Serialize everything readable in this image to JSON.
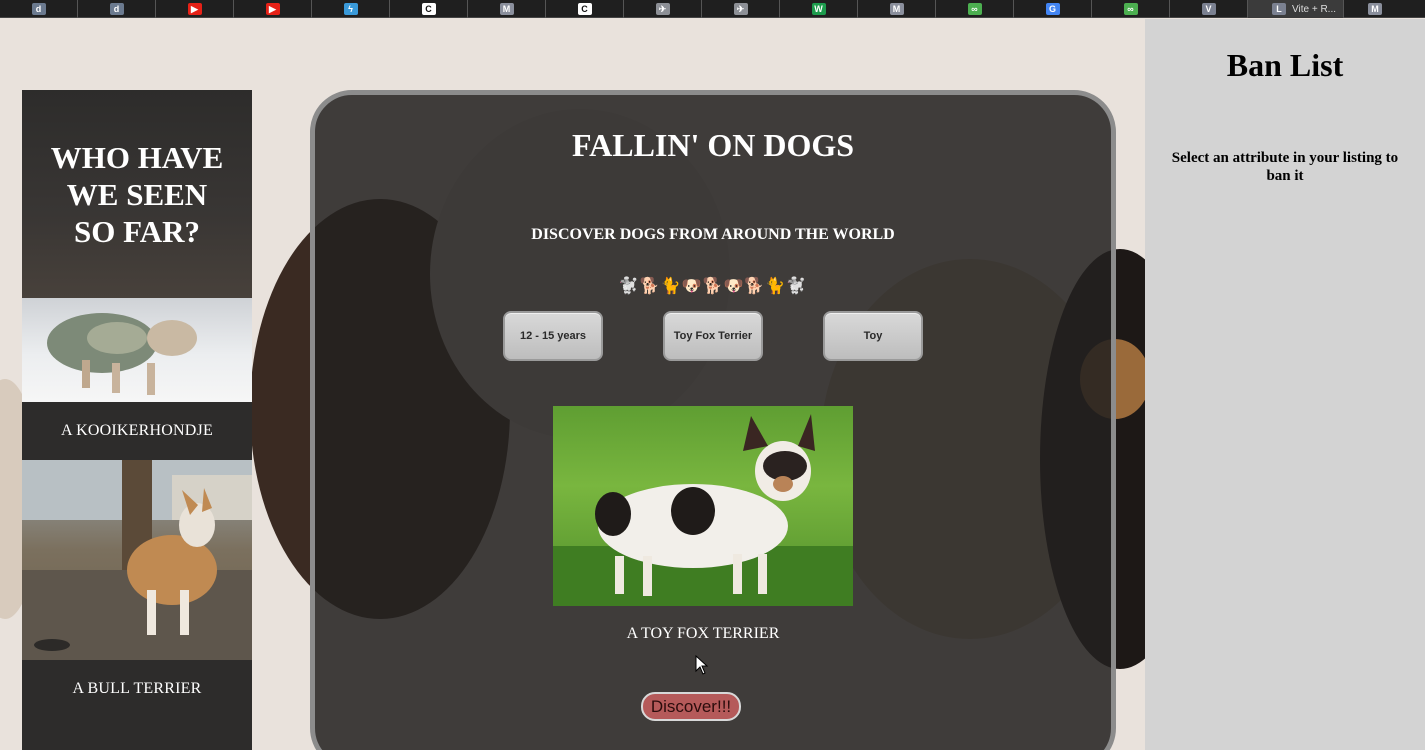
{
  "browser": {
    "tabs": [
      {
        "icon": "dict-icon",
        "label": "",
        "color": "#6b7a8f"
      },
      {
        "icon": "dict-icon",
        "label": "",
        "color": "#6b7a8f"
      },
      {
        "icon": "youtube-icon",
        "label": "",
        "color": "#e62117"
      },
      {
        "icon": "youtube-icon",
        "label": "",
        "color": "#e62117"
      },
      {
        "icon": "bolt-icon",
        "label": "",
        "color": "#3a9ad9"
      },
      {
        "icon": "c-icon",
        "label": "",
        "color": "#ffffff"
      },
      {
        "icon": "m-icon",
        "label": "",
        "color": "#8a8f9c"
      },
      {
        "icon": "c-icon",
        "label": "",
        "color": "#ffffff"
      },
      {
        "icon": "plane-icon",
        "label": "",
        "color": "#8d9096"
      },
      {
        "icon": "plane-icon",
        "label": "",
        "color": "#8d9096"
      },
      {
        "icon": "w-icon",
        "label": "",
        "color": "#1d9c4d"
      },
      {
        "icon": "m-icon",
        "label": "",
        "color": "#8a8f9c"
      },
      {
        "icon": "infinity-icon",
        "label": "",
        "color": "#4caf50"
      },
      {
        "icon": "google-icon",
        "label": "",
        "color": "#4285f4"
      },
      {
        "icon": "infinity-icon",
        "label": "",
        "color": "#4caf50"
      },
      {
        "icon": "v-icon",
        "label": "",
        "color": "#7b8191"
      },
      {
        "icon": "l-icon",
        "label": "Vite + R...",
        "color": "#7b8191"
      },
      {
        "icon": "m-icon",
        "label": "",
        "color": "#8a8f9c"
      }
    ]
  },
  "gallery": {
    "title": "WHO HAVE WE SEEN SO FAR?",
    "items": [
      {
        "caption": "A KOOIKERHONDJE"
      },
      {
        "caption": "A BULL TERRIER"
      }
    ]
  },
  "main": {
    "title": "FALLIN' ON DOGS",
    "subtitle": "DISCOVER DOGS FROM AROUND THE WORLD",
    "emoji_row": "🐩🐕🐈🐶🐕🐶🐕🐈🐩",
    "attributes": [
      "12 - 15 years",
      "Toy Fox Terrier",
      "Toy"
    ],
    "dog_caption": "A TOY FOX TERRIER",
    "discover_label": "Discover!!!"
  },
  "ban_list": {
    "title": "Ban List",
    "help": "Select an attribute in your listing to ban it"
  },
  "colors": {
    "card_bg": "#232120",
    "banlist_bg": "#d3d3d3",
    "discover_btn": "#b55a5a"
  }
}
